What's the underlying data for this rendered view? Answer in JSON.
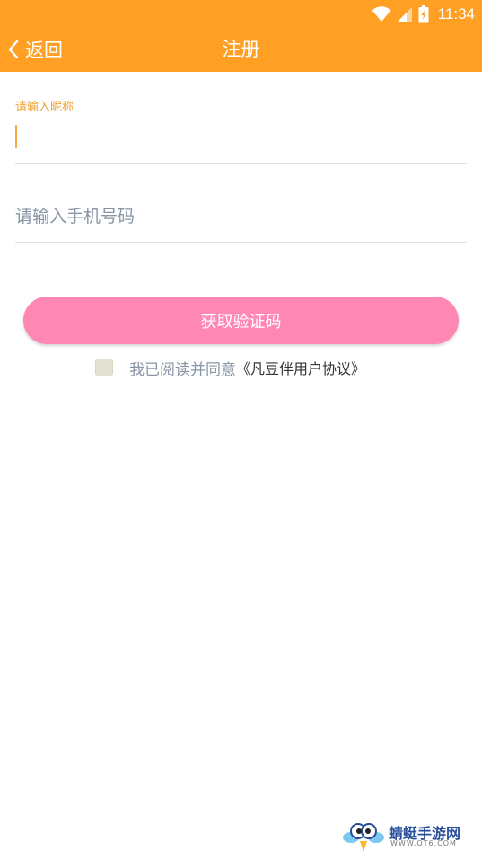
{
  "status_bar": {
    "time": "11:34"
  },
  "nav": {
    "back_label": "返回",
    "title": "注册"
  },
  "form": {
    "nickname_label": "请输入昵称",
    "phone_placeholder": "请输入手机号码",
    "get_code_button": "获取验证码",
    "agree_text": "我已阅读并同意",
    "agreement_link": "《凡豆伴用户协议》"
  },
  "watermark": {
    "brand": "蜻蜓手游网",
    "url": "WWW.QT6.COM"
  },
  "colors": {
    "header": "#FFA025",
    "label_accent": "#F0A030",
    "button": "#FF87B3",
    "placeholder": "#8895A5"
  }
}
